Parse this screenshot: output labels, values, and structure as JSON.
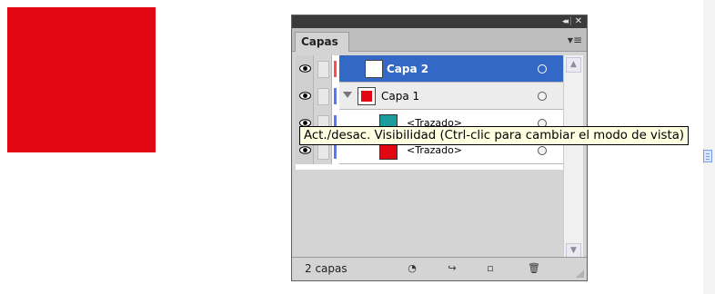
{
  "artboard": {
    "square_color": "#e30613"
  },
  "panel": {
    "title_buttons": {
      "collapse": "◂◂",
      "separator": "|",
      "close": "✕"
    },
    "tab": "Capas",
    "menu_icon": "panel-menu-icon",
    "layers": [
      {
        "name": "Capa 2",
        "selected": true,
        "type": "layer",
        "color": "#ff4d4d"
      },
      {
        "name": "Capa 1",
        "selected": false,
        "type": "layer",
        "color": "#4d7cff",
        "expanded": true
      },
      {
        "name": "<Trazado>",
        "selected": false,
        "type": "path",
        "color": "#4d7cff",
        "thumb": "teal"
      },
      {
        "name": "<Trazado>",
        "selected": false,
        "type": "path",
        "color": "#4d7cff",
        "thumb": "red"
      }
    ],
    "footer": {
      "count_label": "2 capas",
      "icons": [
        "make-clipping-mask-icon",
        "create-sublayer-icon",
        "new-layer-icon",
        "delete-icon"
      ]
    }
  },
  "tooltip": {
    "text": "Act./desac. Visibilidad (Ctrl-clic para cambiar el modo de vista)"
  },
  "colors": {
    "selection": "#3468c6",
    "panel_bg": "#d4d4d4",
    "title_bar": "#3a3a3a"
  }
}
